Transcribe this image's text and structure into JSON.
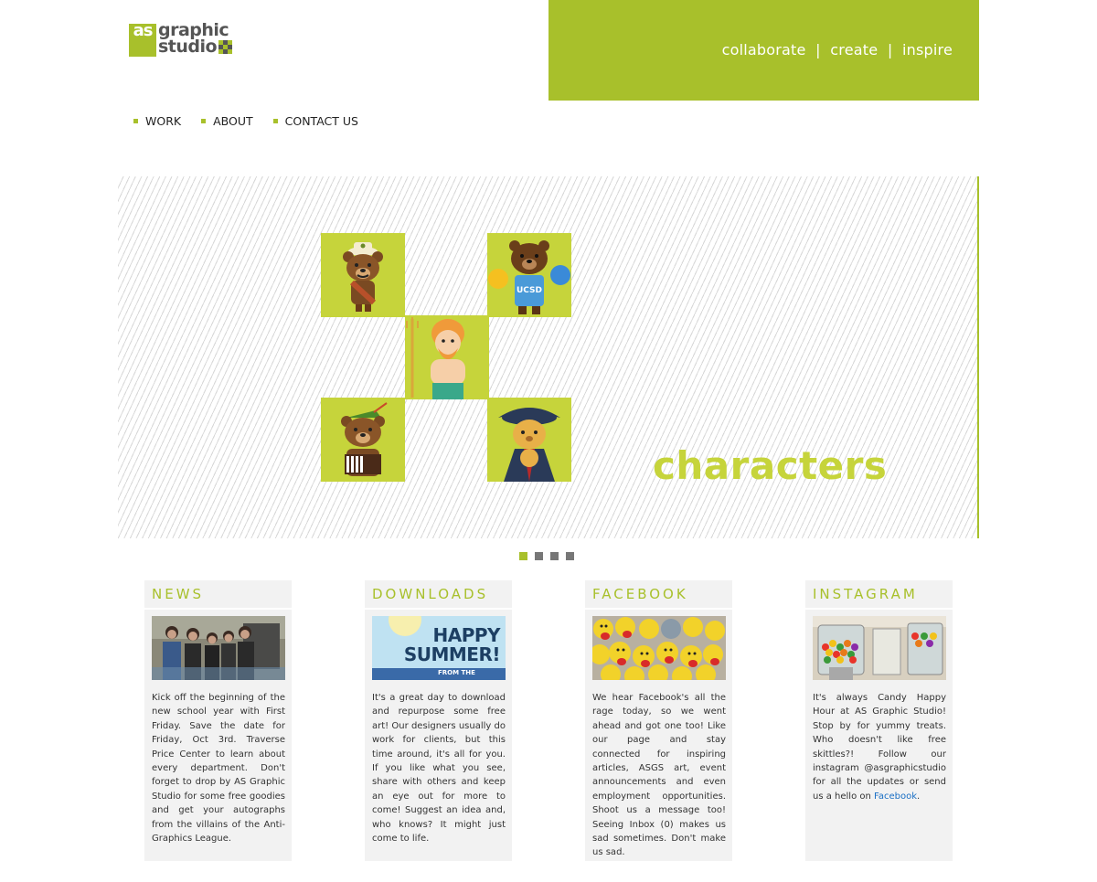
{
  "header": {
    "logo_as": "as",
    "logo_line1": "graphic",
    "logo_line2": "studio",
    "tagline": "collaborate  |  create  |  inspire"
  },
  "nav": [
    {
      "label": "WORK"
    },
    {
      "label": "ABOUT"
    },
    {
      "label": "CONTACT US"
    }
  ],
  "slider": {
    "caption": "characters",
    "active_slide": 1,
    "slide_count": 4,
    "tiles": [
      "scout-bear",
      "cheerleader-bear-ucsd",
      "triton-king",
      "robin-hood-bear",
      "pirate-bear"
    ],
    "cheer_text": "UCSD"
  },
  "columns": [
    {
      "title": "NEWS",
      "image": "team-photo",
      "text": "Kick off the beginning of the new school year with First Friday. Save the date for Friday, Oct 3rd. Traverse Price Center to learn about every department. Don't forget to drop by AS Graphic Studio for some free goodies and get your autographs from the villains of the Anti-Graphics League."
    },
    {
      "title": "DOWNLOADS",
      "image": "happy-summer-banner",
      "banner_line1": "HAPPY",
      "banner_line2": "SUMMER!",
      "banner_footer": "FROM THE",
      "text": "It's a great day to download and repurpose some free art! Our designers usually do work for clients, but this time around, it's all for you. If you like what you see, share with others and keep an eye out for more to come! Suggest an idea and, who knows? It might just come to life."
    },
    {
      "title": "FACEBOOK",
      "image": "plush-characters-photo",
      "text": "We hear Facebook's all the rage today, so we went ahead and got one too! Like our page and stay connected for inspiring articles, ASGS art, event announcements and even employment opportunities. Shoot us a message too! Seeing Inbox (0) makes us sad sometimes. Don't make us sad."
    },
    {
      "title": "INSTAGRAM",
      "image": "candy-machines-photo",
      "text_before_link": "It's always Candy Happy Hour at AS Graphic Studio! Stop by for yummy treats. Who doesn't like free skittles?! Follow our instagram @asgraphicstudio for all the updates or send us a hello on ",
      "link": "Facebook",
      "text_after_link": "."
    }
  ],
  "colors": {
    "accent": "#a8c02b",
    "tile": "#c6d43b",
    "link": "#1a6fc4"
  }
}
